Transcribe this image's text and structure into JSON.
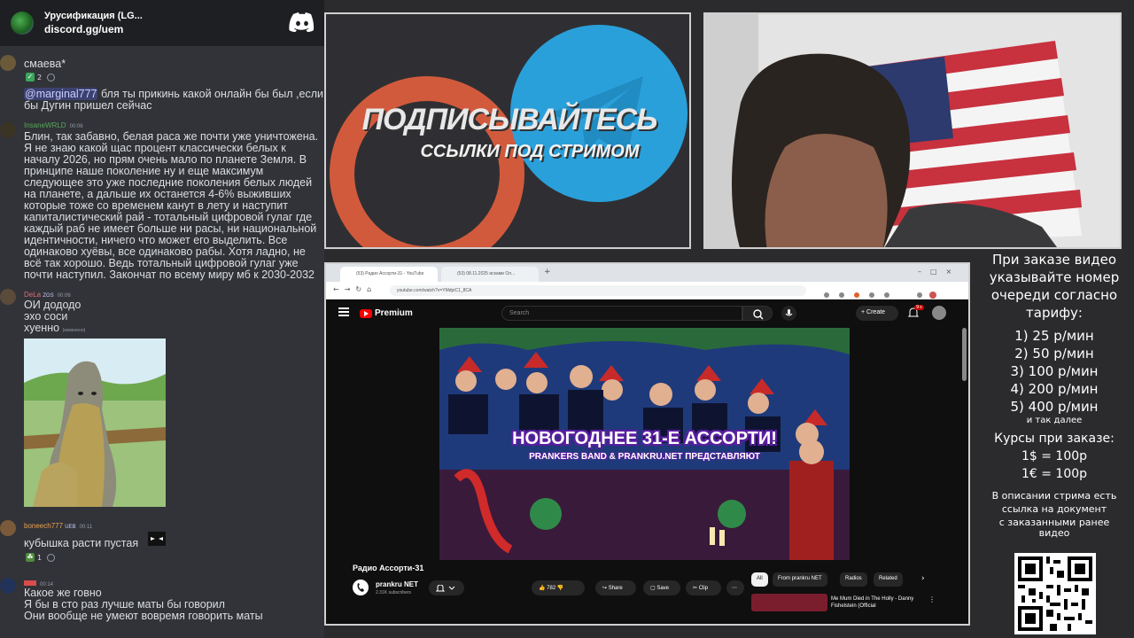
{
  "chat": {
    "server_title": "Урусификация (LG...",
    "server_link": "discord.gg/uem",
    "messages": [
      {
        "id": "m1",
        "text": "смаева*",
        "reaction_count": "2"
      },
      {
        "id": "m2",
        "mention": "@marginal777",
        "text": " бля ты прикинь какой онлайн бы был ,если бы Дугин пришел сейчас"
      },
      {
        "id": "m3",
        "user": "InsaneWRLD",
        "time": "00:06",
        "text": "Блин, так забавно, белая раса же почти уже уничтожена. Я не знаю какой щас процент классически белых к началу 2026, но прям очень мало по планете Земля.  В принципе наше поколение ну и еще максимум следующее это уже последние поколения белых людей на планете, а дальше их останется 4-6% выживших которые тоже со временем канут в лету и наступит капиталистический рай - тотальный цифровой гулаг где каждый раб не имеет больше ни расы, ни национальной идентичности, ничего что может его выделить. Все одинаково хуёвы, все одинаково рабы. Хотя ладно, не всё так хорошо. Ведь тотальный цифровой гулаг уже почти наступил. Закончат по всему миру мб к 2030-2032"
      },
      {
        "id": "m4",
        "user": "DeLa",
        "tag": "ZGS",
        "time": "00:06",
        "lines": [
          "ОИ дододо",
          "эхо соси",
          "хуенно"
        ],
        "edited": "(изменено)"
      },
      {
        "id": "m5",
        "user": "boneech777",
        "tag": "UEB",
        "time": "00:11",
        "text": "кубышка расти пустая",
        "reaction_count": "1"
      },
      {
        "id": "m6",
        "time": "00:14",
        "lines": [
          "Какое же говно",
          "Я бы в сто раз лучше маты бы говорил",
          "Они вообще не умеют вовремя говорить маты"
        ]
      }
    ]
  },
  "promo": {
    "title": "ПОДПИСЫВАЙТЕСЬ",
    "subtitle": "ССЫЛКИ ПОД СТРИМОМ"
  },
  "browser": {
    "tabs": [
      "(53) Радио Ассорти-31 - YouTube",
      "(53) 08.11.2025 исками Ол..."
    ],
    "url": "youtube.com/watch?v=YMdpiC1_8CA",
    "brand": "Premium",
    "search_placeholder": "Search",
    "create_label": "Create",
    "notif_badge": "9+",
    "video_overlay_title": "НОВОГОДНЕЕ 31-Е АССОРТИ!",
    "video_overlay_sub": "PRANKERS BAND & PRANKRU.NET ПРЕДСТАВЛЯЮТ",
    "video_title": "Радио Ассорти-31",
    "channel_name": "prankru NET",
    "subscribers": "2.31K subscribers",
    "likes": "782",
    "share": "Share",
    "save": "Save",
    "clip": "Clip",
    "chips": [
      "All",
      "From prankru NET",
      "Radios",
      "Related"
    ],
    "rec_title": "Me Mum Died in The Holly - Danny Fishelstein (Official"
  },
  "info": {
    "intro": [
      "При заказе видео",
      "указывайте номер",
      "очереди согласно",
      "тарифу:"
    ],
    "tariffs": [
      "1) 25 р/мин",
      "2) 50 р/мин",
      "3) 100 р/мин",
      "4) 200 р/мин",
      "5) 400 р/мин"
    ],
    "tariffs_more": "и так далее",
    "rates_title": "Курсы при заказе:",
    "rates": [
      "1$ = 100р",
      "1€ = 100р"
    ],
    "footer": [
      "В описании стрима есть",
      "ссылка на документ",
      "с заказанными ранее",
      "видео"
    ]
  },
  "colors": {
    "chat_bg": "#313338",
    "mention_bg": "#3c4270",
    "youtube_red": "#ff0000",
    "promo_orange": "#d25a3c",
    "promo_blue": "#2aa0da"
  }
}
